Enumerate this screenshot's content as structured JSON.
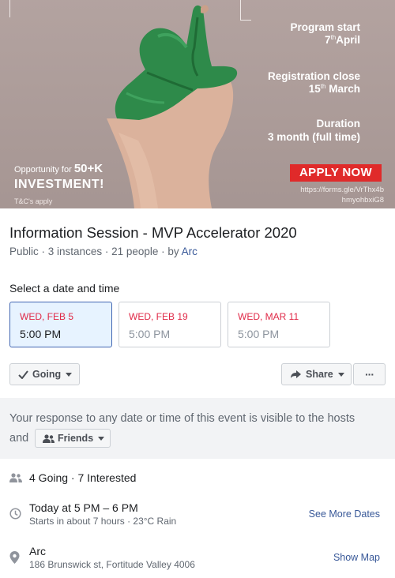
{
  "banner": {
    "program_start_label": "Program start",
    "program_start_value": "7",
    "program_start_suffix": "th",
    "program_start_month": "April",
    "registration_label": "Registration close",
    "registration_value": "15",
    "registration_suffix": "th",
    "registration_month": "March",
    "duration_label": "Duration",
    "duration_value": "3 month (full time)",
    "opportunity_text": "Opportunity for",
    "opportunity_amount": "50+K",
    "investment_text": "INVESTMENT!",
    "tc_text": "T&C's apply",
    "apply_label": "APPLY NOW",
    "url_line1": "https://forms.gle/VrThx4b",
    "url_line2": "hmyohbxiG8",
    "background_color": "#b09f9c",
    "hand_color": "#2e8a4a"
  },
  "event": {
    "title": "Information Session - MVP Accelerator 2020",
    "privacy": "Public",
    "instances": "3 instances",
    "people": "21 people",
    "by_label": "by",
    "host": "Arc"
  },
  "date_select": {
    "label": "Select a date and time",
    "dates": [
      {
        "day": "WED, FEB 5",
        "time": "5:00 PM",
        "selected": true
      },
      {
        "day": "WED, FEB 19",
        "time": "5:00 PM",
        "selected": false
      },
      {
        "day": "WED, MAR 11",
        "time": "5:00 PM",
        "selected": false
      }
    ]
  },
  "actions": {
    "going_label": "Going",
    "share_label": "Share",
    "more_label": "···"
  },
  "notice": {
    "line1": "Your response to any date or time of this event is visible to the hosts",
    "and_label": "and",
    "audience_label": "Friends"
  },
  "details": {
    "attendance": "4 Going · 7 Interested",
    "time_main": "Today at 5 PM – 6 PM",
    "time_sub": "Starts in about 7 hours · 23°C Rain",
    "see_more_dates": "See More Dates",
    "location_name": "Arc",
    "location_address": "186 Brunswick st, Fortitude Valley 4006",
    "show_map": "Show Map"
  },
  "colors": {
    "link": "#385898",
    "date_red": "#e02a48",
    "selected_bg": "#e7f3ff",
    "apply_red": "#e02a2a"
  }
}
